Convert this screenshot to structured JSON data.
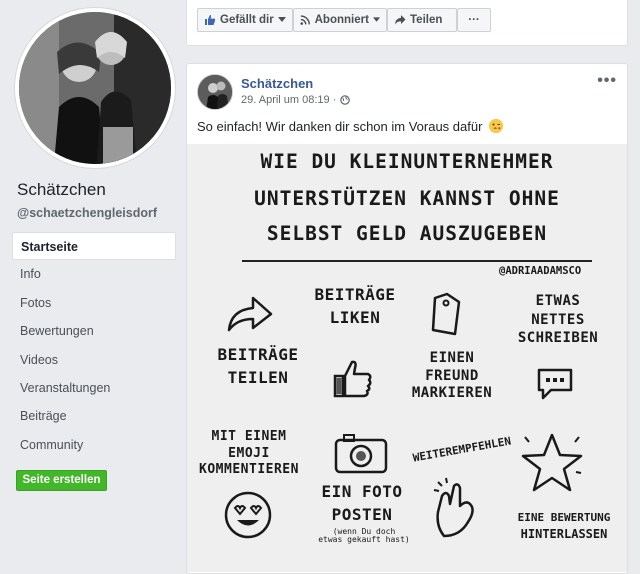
{
  "sidebar": {
    "page_name": "Schätzchen",
    "handle": "@schaetzchengleisdorf",
    "nav": [
      {
        "label": "Startseite",
        "active": true
      },
      {
        "label": "Info"
      },
      {
        "label": "Fotos"
      },
      {
        "label": "Bewertungen"
      },
      {
        "label": "Videos"
      },
      {
        "label": "Veranstaltungen"
      },
      {
        "label": "Beiträge"
      },
      {
        "label": "Community"
      }
    ],
    "create_page_label": "Seite erstellen"
  },
  "actions": {
    "like_label": "Gefällt dir",
    "follow_label": "Abonniert",
    "share_label": "Teilen",
    "more_label": "···"
  },
  "post": {
    "author": "Schätzchen",
    "timestamp": "29. April um 08:19 ·",
    "more_label": "•••",
    "text": "So einfach! Wir danken dir schon im Voraus dafür",
    "image": {
      "title_line1": "WIE DU KLEINUNTERNEHMER",
      "title_line2": "UNTERSTÜTZEN KANNST OHNE",
      "title_line3": "SELBST GELD AUSZUGEBEN",
      "credit": "@ADRIAADAMSCO",
      "items": {
        "teilen": [
          "BEITRÄGE",
          "TEILEN"
        ],
        "liken": [
          "BEITRÄGE",
          "LIKEN"
        ],
        "nettes": [
          "ETWAS",
          "NETTES",
          "SCHREIBEN"
        ],
        "markieren": [
          "EINEN",
          "FREUND",
          "MARKIEREN"
        ],
        "emoji": [
          "MIT EINEM",
          "EMOJI",
          "KOMMENTIEREN"
        ],
        "foto": [
          "EIN FOTO",
          "POSTEN"
        ],
        "foto_note": [
          "(wenn Du doch",
          "etwas gekauft hast)"
        ],
        "weiter": "WEITEREMPFEHLEN",
        "bewertung": [
          "EINE BEWERTUNG",
          "HINTERLASSEN"
        ]
      }
    }
  }
}
